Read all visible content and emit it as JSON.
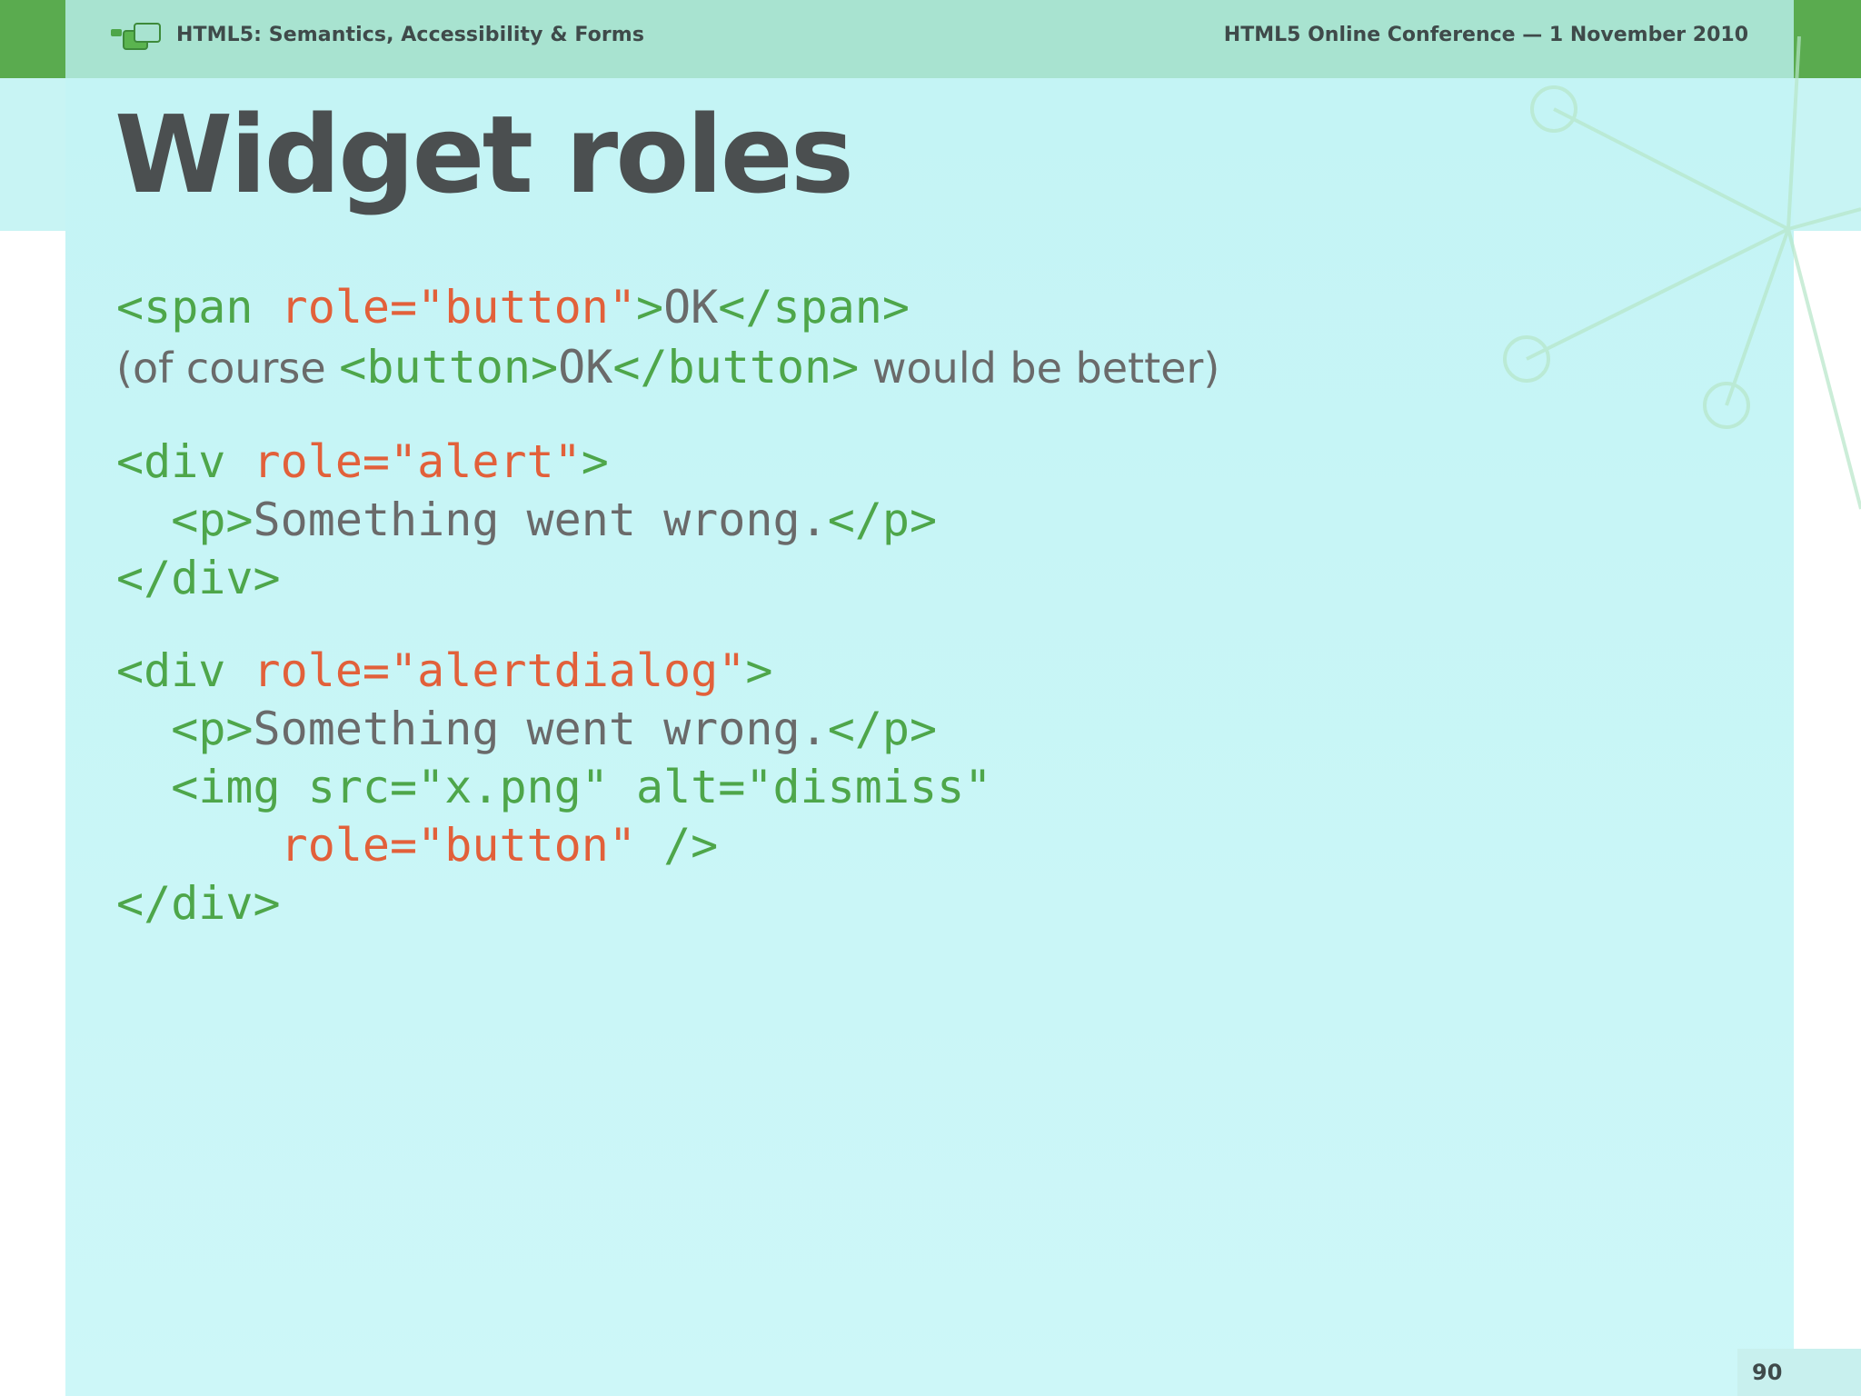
{
  "header": {
    "left_title": "HTML5: Semantics, Accessibility & Forms",
    "right_title": "HTML5 Online Conference — 1 November 2010",
    "logo_icon": "speech-bubbles-icon"
  },
  "slide": {
    "title": "Widget roles",
    "page_number": "90"
  },
  "code": {
    "line1": {
      "open": "<span ",
      "attr": "role=\"button\"",
      "close": ">",
      "text": "OK",
      "end": "</span>"
    },
    "line2": {
      "before": "(of course ",
      "tag_open": "<button>",
      "text": "OK",
      "tag_close": "</button>",
      "after": " would be better)"
    },
    "block2": {
      "line1": {
        "open": "<div ",
        "attr": "role=\"alert\"",
        "close": ">"
      },
      "line2": {
        "indent": "  ",
        "open": "<p>",
        "text": "Something went wrong.",
        "close": "</p>"
      },
      "line3": {
        "close": "</div>"
      }
    },
    "block3": {
      "line1": {
        "open": "<div ",
        "attr": "role=\"alertdialog\"",
        "close": ">"
      },
      "line2": {
        "indent": "  ",
        "open": "<p>",
        "text": "Something went wrong.",
        "close": "</p>"
      },
      "line3": {
        "indent": "  ",
        "tag": "<img src=\"x.png\" alt=\"dismiss\""
      },
      "line4": {
        "indent": "      ",
        "attr": "role=\"button\"",
        "close": " />"
      },
      "line5": {
        "close": "</div>"
      }
    }
  },
  "colors": {
    "tag": "#4ea64a",
    "attribute": "#e2603a",
    "text": "#6a6a6a",
    "title": "#4b4f50",
    "header_bar": "#a8e3d0",
    "accent_green": "#5aab4f",
    "panel": "#c4f4f5"
  }
}
